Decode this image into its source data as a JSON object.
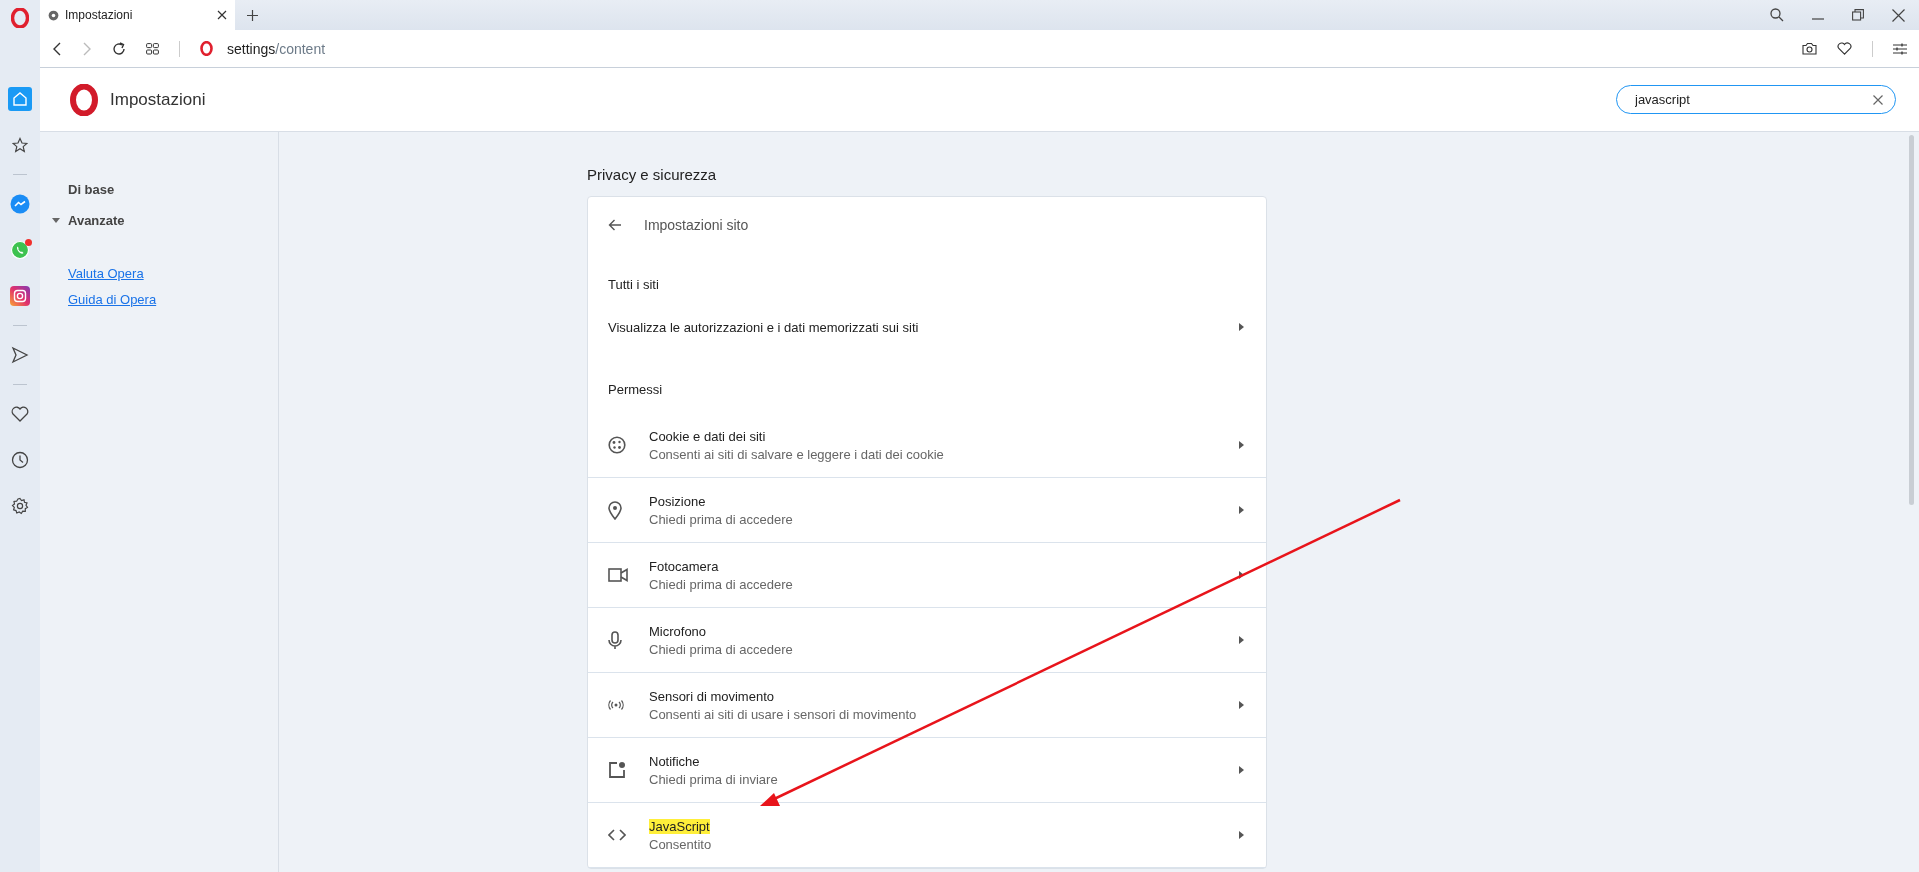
{
  "tabs": [
    {
      "title": "Impostazioni",
      "selected": true
    }
  ],
  "address": {
    "host": "settings",
    "path": "/content"
  },
  "sidebar": {
    "items": [
      {
        "kind": "home",
        "selected": true,
        "notification": false
      },
      {
        "kind": "star",
        "selected": false,
        "notification": false
      },
      {
        "kind": "separator",
        "selected": false,
        "notification": false
      },
      {
        "kind": "messenger",
        "selected": false,
        "notification": false
      },
      {
        "kind": "whatsapp",
        "selected": false,
        "notification": true
      },
      {
        "kind": "instagram",
        "selected": false,
        "notification": false
      },
      {
        "kind": "separator",
        "selected": false,
        "notification": false
      },
      {
        "kind": "send",
        "selected": false,
        "notification": false
      },
      {
        "kind": "separator",
        "selected": false,
        "notification": false
      },
      {
        "kind": "heart",
        "selected": false,
        "notification": false
      },
      {
        "kind": "clock",
        "selected": false,
        "notification": false
      },
      {
        "kind": "gear",
        "selected": false,
        "notification": false
      }
    ]
  },
  "header": {
    "title": "Impostazioni",
    "search": {
      "value": "javascript"
    }
  },
  "nav": {
    "items": [
      {
        "label": "Di base",
        "kind": "plain"
      },
      {
        "label": "Avanzate",
        "expanded": true,
        "kind": "caret"
      }
    ],
    "links": [
      "Valuta Opera",
      "Guida di Opera"
    ]
  },
  "section_title": "Privacy e sicurezza",
  "card": {
    "title": "Impostazioni sito",
    "all_sites_heading": "Tutti i siti",
    "all_sites_link": "Visualizza le autorizzazioni e i dati memorizzati sui siti",
    "permissions_heading": "Permessi",
    "permissions": [
      {
        "kind": "cookie",
        "title": "Cookie e dati dei siti",
        "subtitle": "Consenti ai siti di salvare e leggere i dati dei cookie",
        "highlighted": false
      },
      {
        "kind": "location",
        "title": "Posizione",
        "subtitle": "Chiedi prima di accedere",
        "highlighted": false
      },
      {
        "kind": "camera",
        "title": "Fotocamera",
        "subtitle": "Chiedi prima di accedere",
        "highlighted": false
      },
      {
        "kind": "mic",
        "title": "Microfono",
        "subtitle": "Chiedi prima di accedere",
        "highlighted": false
      },
      {
        "kind": "sensors",
        "title": "Sensori di movimento",
        "subtitle": "Consenti ai siti di usare i sensori di movimento",
        "highlighted": false
      },
      {
        "kind": "notifications",
        "title": "Notifiche",
        "subtitle": "Chiedi prima di inviare",
        "highlighted": false
      },
      {
        "kind": "code",
        "title": "JavaScript",
        "subtitle": "Consentito",
        "highlighted": true
      }
    ]
  }
}
